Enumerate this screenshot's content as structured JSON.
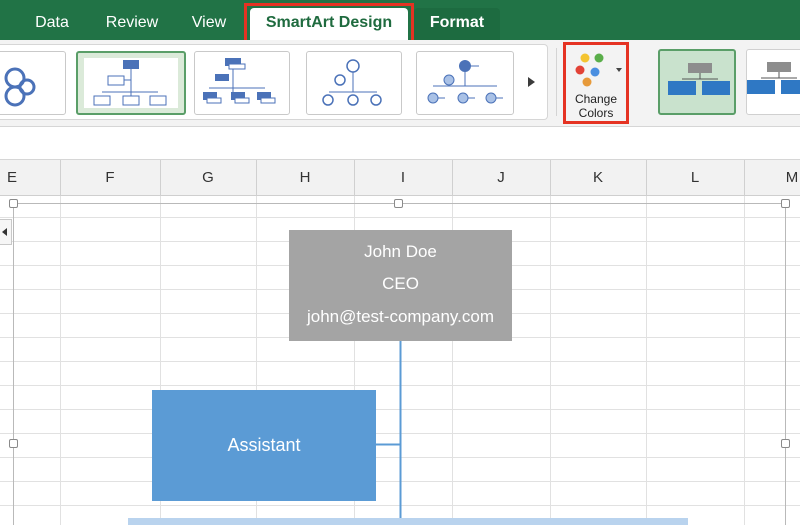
{
  "ribbon": {
    "tabs": [
      {
        "label": "Data",
        "active": false
      },
      {
        "label": "Review",
        "active": false
      },
      {
        "label": "View",
        "active": false
      },
      {
        "label": "SmartArt Design",
        "active": true
      },
      {
        "label": "Format",
        "active": false
      }
    ],
    "change_colors": {
      "label_line1": "Change",
      "label_line2": "Colors",
      "dot_colors": [
        "#f4c430",
        "#5aae4a",
        "#e24236",
        "#4a8fe0",
        "#e79a3a"
      ]
    },
    "highlight_color": "#e53323",
    "tab_bar_color": "#217346"
  },
  "sheet": {
    "columns": [
      "E",
      "F",
      "G",
      "H",
      "I",
      "J",
      "K",
      "L",
      "M"
    ]
  },
  "smartart": {
    "ceo_box": {
      "name": "John Doe",
      "title": "CEO",
      "email": "john@test-company.com",
      "color": "#a4a4a4"
    },
    "assistant_box": {
      "label": "Assistant",
      "color": "#5b9bd5"
    },
    "connector_color": "#5b9bd5"
  }
}
